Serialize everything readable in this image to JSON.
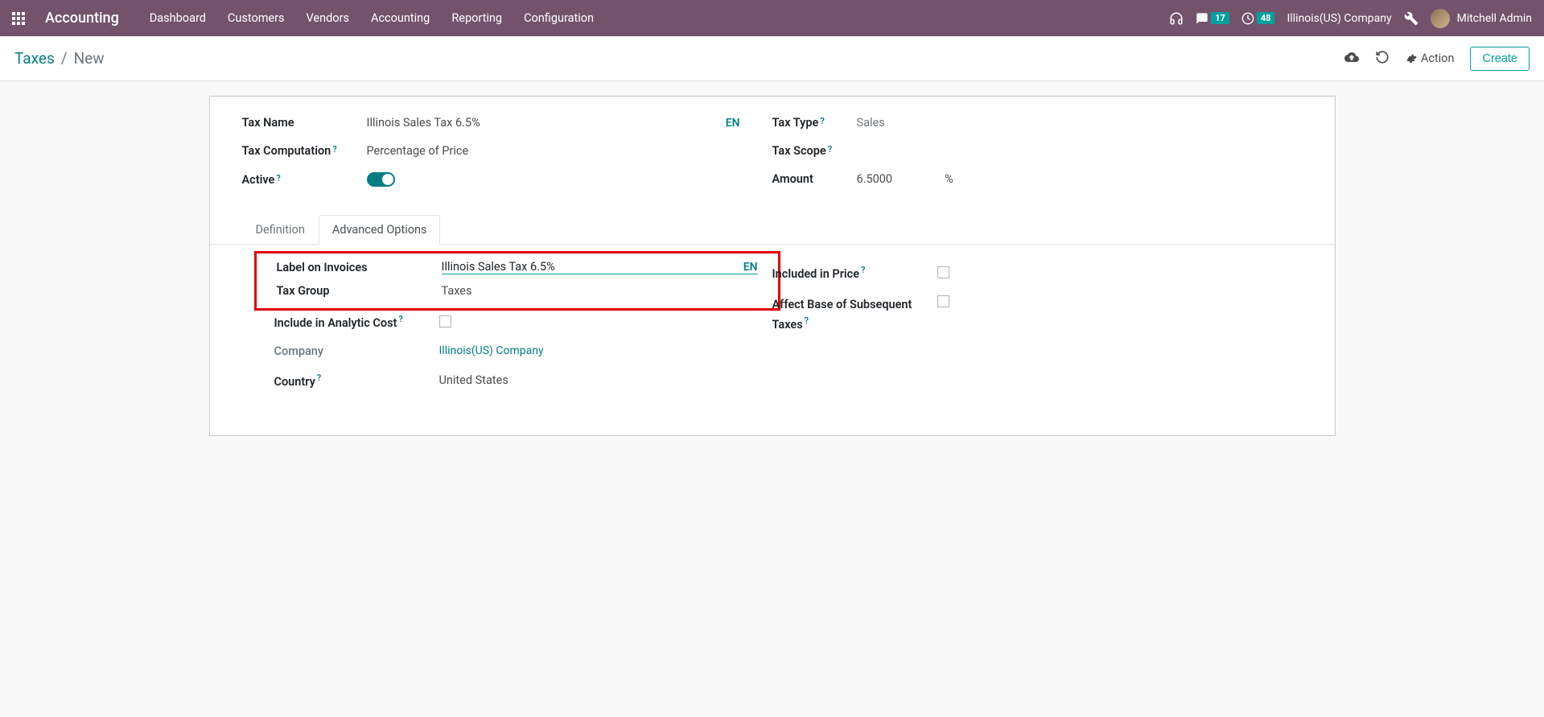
{
  "navbar": {
    "brand": "Accounting",
    "links": [
      "Dashboard",
      "Customers",
      "Vendors",
      "Accounting",
      "Reporting",
      "Configuration"
    ],
    "messages_count": "17",
    "activities_count": "48",
    "company": "Illinois(US) Company",
    "user": "Mitchell Admin"
  },
  "breadcrumb": {
    "parent": "Taxes",
    "current": "New"
  },
  "actions": {
    "action_label": "Action",
    "create_label": "Create"
  },
  "form": {
    "tax_name_label": "Tax Name",
    "tax_name_value": "Illinois Sales Tax 6.5%",
    "tax_name_lang": "EN",
    "tax_computation_label": "Tax Computation",
    "tax_computation_value": "Percentage of Price",
    "active_label": "Active",
    "tax_type_label": "Tax Type",
    "tax_type_value": "Sales",
    "tax_scope_label": "Tax Scope",
    "amount_label": "Amount",
    "amount_value": "6.5000",
    "amount_unit": "%"
  },
  "tabs": {
    "definition": "Definition",
    "advanced": "Advanced Options"
  },
  "advanced": {
    "label_on_invoices_label": "Label on Invoices",
    "label_on_invoices_value": "Illinois Sales Tax 6.5%",
    "label_on_invoices_lang": "EN",
    "tax_group_label": "Tax Group",
    "tax_group_value": "Taxes",
    "include_analytic_label": "Include in Analytic Cost",
    "company_label": "Company",
    "company_value": "Illinois(US) Company",
    "country_label": "Country",
    "country_value": "United States",
    "included_in_price_label": "Included in Price",
    "affect_base_label": "Affect Base of Subsequent Taxes"
  }
}
